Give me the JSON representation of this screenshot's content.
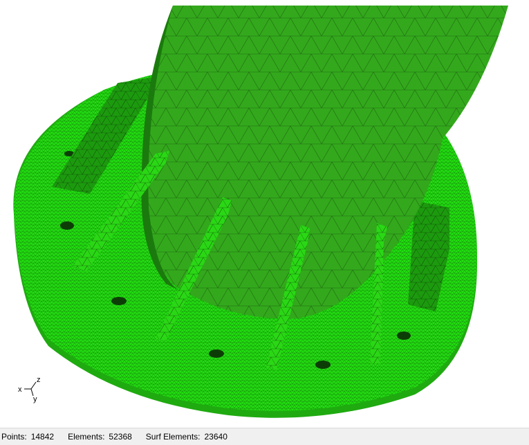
{
  "viewport": {
    "mesh_color": "#22cc11",
    "mesh_dark": "#1a9e0e",
    "wire_color": "#0a2a05",
    "background": "#ffffff"
  },
  "axes": {
    "x": "x",
    "y": "y",
    "z": "z"
  },
  "status": {
    "points_label": "Points:",
    "points_value": "14842",
    "elements_label": "Elements:",
    "elements_value": "52368",
    "surf_label": "Surf Elements:",
    "surf_value": "23640"
  }
}
